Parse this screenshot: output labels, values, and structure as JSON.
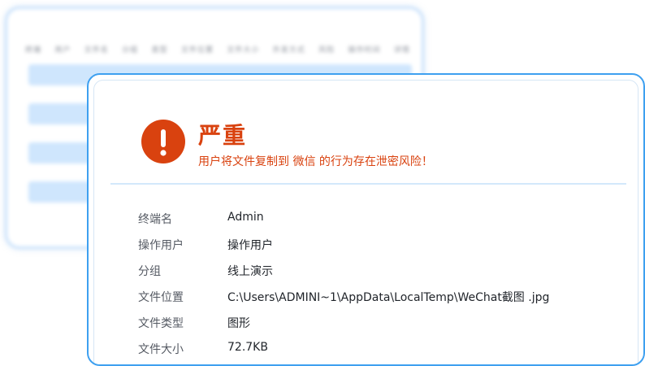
{
  "background_table": {
    "headers": [
      "终端",
      "用户",
      "文件名",
      "分组",
      "类型",
      "文件位置",
      "文件大小",
      "外发方式",
      "风险",
      "操作时间",
      "详情"
    ]
  },
  "alert": {
    "icon": "exclamation-icon",
    "level": "严重",
    "description": "用户将文件复制到 微信 的行为存在泄密风险！",
    "accent_color": "#d9420f",
    "border_color": "#3ea0f0"
  },
  "details": [
    {
      "key": "终端名",
      "value": "Admin"
    },
    {
      "key": "操作用户",
      "value": "操作用户"
    },
    {
      "key": "分组",
      "value": "线上演示"
    },
    {
      "key": "文件位置",
      "value": "C:\\Users\\ADMINI~1\\AppData\\LocalTemp\\WeChat截图 .jpg"
    },
    {
      "key": "文件类型",
      "value": "图形"
    },
    {
      "key": "文件大小",
      "value": "72.7KB"
    }
  ]
}
